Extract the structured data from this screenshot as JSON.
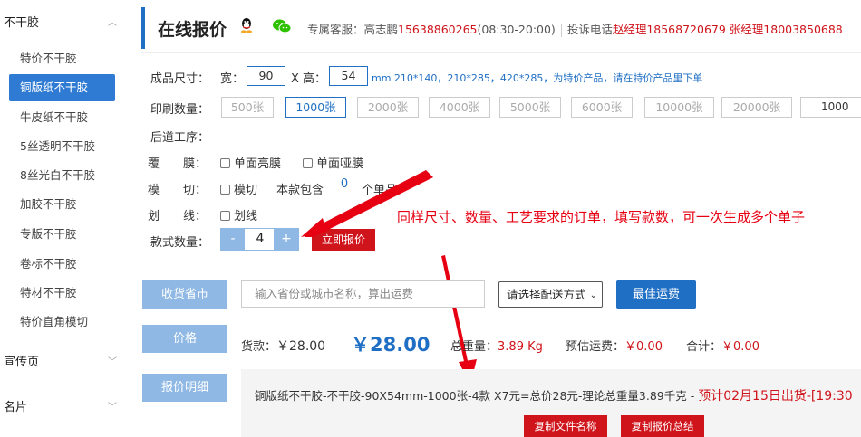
{
  "sidebar": {
    "group_top": "不干胶",
    "items": [
      "特价不干胶",
      "铜版纸不干胶",
      "牛皮纸不干胶",
      "5丝透明不干胶",
      "8丝光白不干胶",
      "加胶不干胶",
      "专版不干胶",
      "卷标不干胶",
      "特材不干胶",
      "特价直角模切"
    ],
    "group_promo": "宣传页",
    "group_card": "名片"
  },
  "header": {
    "title": "在线报价",
    "service_label": "专属客服：高志鹏",
    "service_phone": "15638860265",
    "service_hours": "(08:30-20:00)",
    "complaint_label": "投诉电话",
    "complaint_text": "赵经理18568720679 张经理18003850688"
  },
  "size": {
    "label": "成品尺寸：",
    "width_label": "宽：",
    "width": "90",
    "height_label": "X 高：",
    "height": "54",
    "tip": "mm 210*140，210*285，420*285，为特价产品，请在特价产品里下单"
  },
  "quantity": {
    "label": "印刷数量：",
    "options": [
      "500张",
      "1000张",
      "2000张",
      "4000张",
      "5000张",
      "6000张",
      "10000张",
      "20000张"
    ],
    "selected": "1000张",
    "custom": "1000"
  },
  "post": {
    "label": "后道工序："
  },
  "film": {
    "label": "覆　　膜：",
    "opt1": "单面亮膜",
    "opt2": "单面哑膜"
  },
  "diecut": {
    "label": "模　　切：",
    "opt": "模切",
    "count_label": "本款包含",
    "count": "0",
    "unit": "个单品"
  },
  "scribe": {
    "label": "划　　线：",
    "opt": "划线"
  },
  "styles": {
    "label": "款式数量：",
    "minus": "-",
    "value": "4",
    "plus": "+",
    "quote_button": "立即报价"
  },
  "annotation": "同样尺寸、数量、工艺要求的订单，填写款数，可一次生成多个单子",
  "shipping": {
    "province_button": "收货省市",
    "region_placeholder": "输入省份或城市名称，算出运费",
    "method": "请选择配送方式",
    "best_button": "最佳运费"
  },
  "price": {
    "button": "价格",
    "goods_label": "货款：",
    "goods_value": "￥28.00",
    "big_value": "￥28.00",
    "weight_label": "总重量：",
    "weight_value": "3.89 Kg",
    "freight_label": "预估运费：",
    "freight_value": "￥0.00",
    "total_label": "合计：",
    "total_value": "￥0.00"
  },
  "detail": {
    "button": "报价明细",
    "text": "铜版纸不干胶-不干胶-90X54mm-1000张-4款 X7元=总价28元-理论总重量3.89千克 - ",
    "ship_date": "预计02月15日出货-[19:30",
    "copy_name": "复制文件名称",
    "copy_summary": "复制报价总结"
  },
  "colors": {
    "accent": "#1f6fc4",
    "red": "#d0141c",
    "light_blue": "#8fb8e4"
  }
}
